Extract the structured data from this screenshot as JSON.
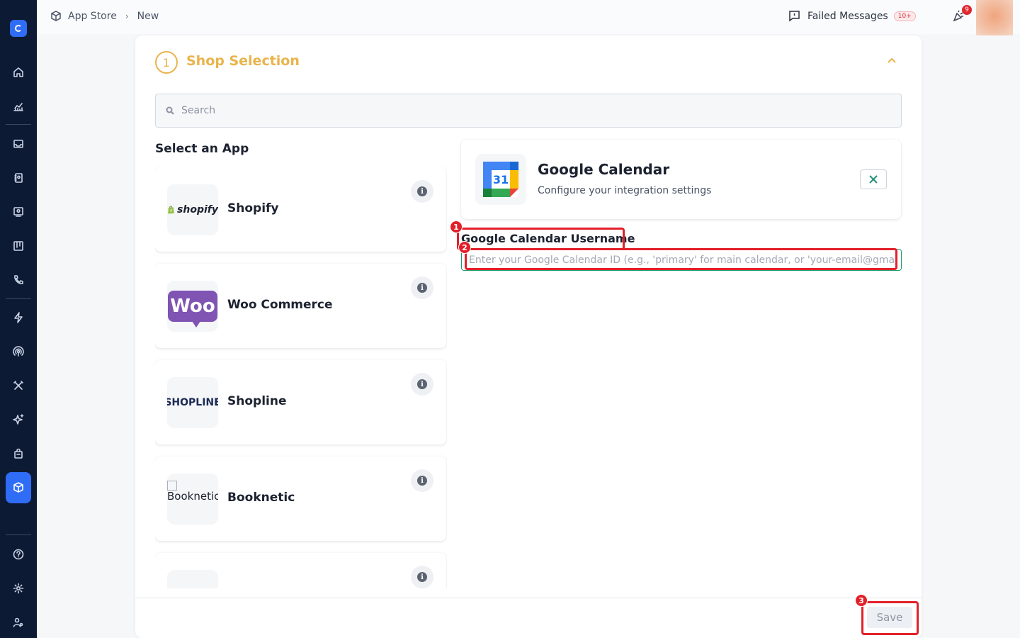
{
  "topbar": {
    "breadcrumb_root": "App Store",
    "breadcrumb_current": "New",
    "failed_messages_label": "Failed Messages",
    "failed_messages_count": "10+",
    "notifications_count": "9"
  },
  "panel": {
    "step_number": "1",
    "step_title": "Shop Selection",
    "search_placeholder": "Search",
    "select_app_heading": "Select an App",
    "apps": [
      {
        "name": "Shopify",
        "logo_text": "shopify"
      },
      {
        "name": "Woo Commerce",
        "logo_text": "Woo"
      },
      {
        "name": "Shopline",
        "logo_text": "SHOPLINE"
      },
      {
        "name": "Booknetic",
        "logo_text": "Booknetic"
      },
      {
        "name": "",
        "logo_text": ""
      }
    ],
    "integration": {
      "title": "Google Calendar",
      "subtitle": "Configure your integration settings",
      "calendar_day": "31",
      "field_label": "Google Calendar Username",
      "field_placeholder": "Enter your Google Calendar ID (e.g., 'primary' for main calendar, or 'your-email@gmail.com')"
    },
    "save_label": "Save"
  },
  "annotations": [
    "1",
    "2",
    "3"
  ],
  "colors": {
    "sidebar_bg": "#0d1a33",
    "accent_blue": "#2f6df6",
    "step_yellow": "#e9b44c",
    "annotation_red": "#e2202a",
    "input_border_green": "#1f9b6a"
  }
}
